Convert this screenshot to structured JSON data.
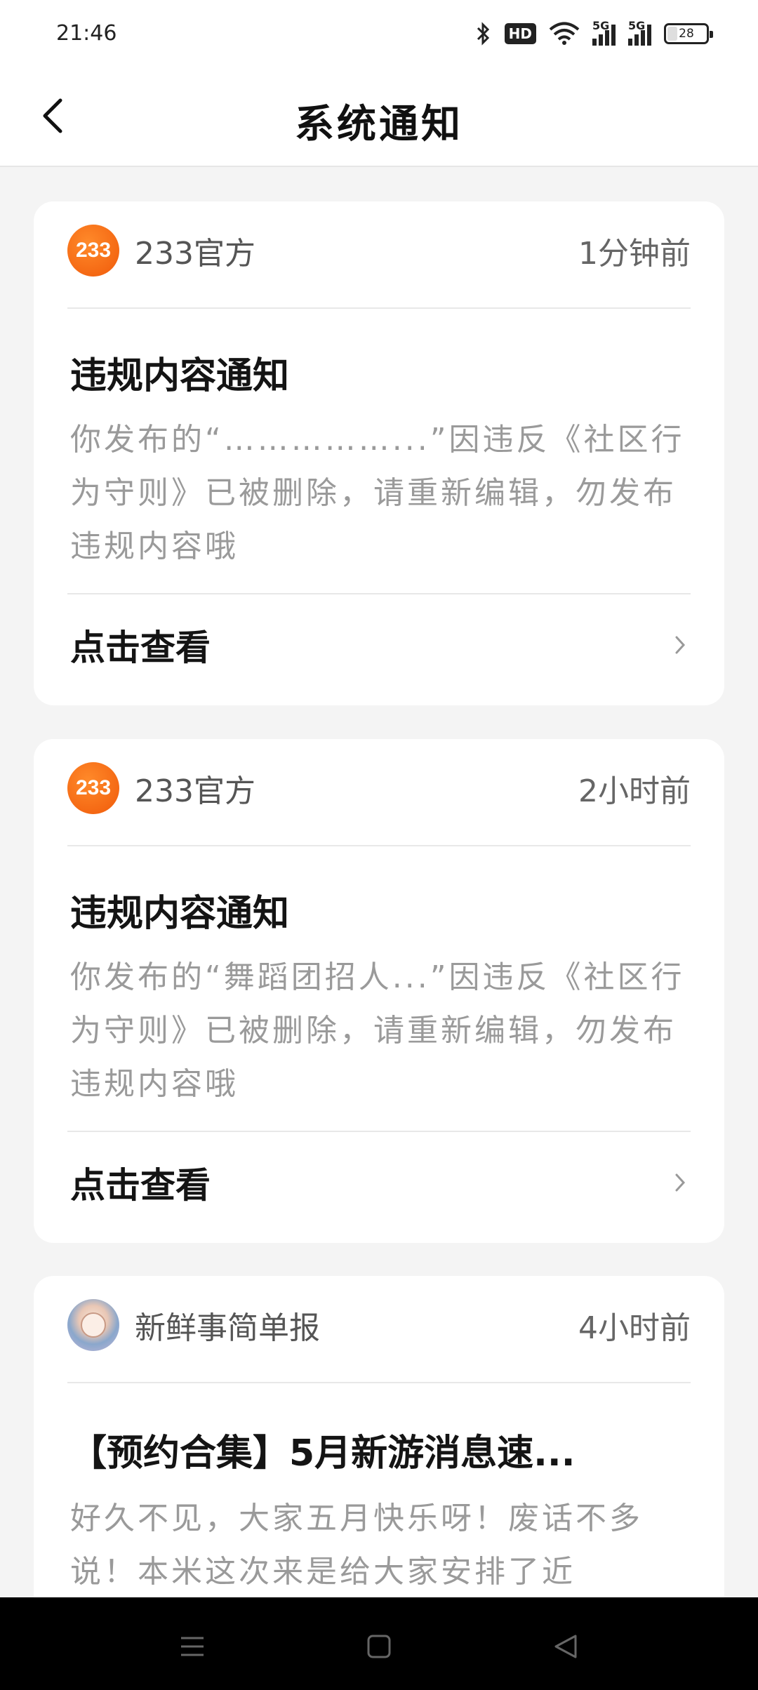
{
  "status_bar": {
    "time": "21:46",
    "hd_badge": "HD",
    "signal1_label": "5G",
    "signal2_label": "5G",
    "battery": "28",
    "icons": [
      "bluetooth-icon",
      "wifi-icon",
      "signal-icon",
      "battery-icon"
    ]
  },
  "header": {
    "title": "系统通知",
    "back_icon": "chevron-left-icon"
  },
  "notifications": [
    {
      "avatar_text": "233",
      "sender": "233官方",
      "time": "1分钟前",
      "title": "违规内容通知",
      "body": "你发布的“……………...”因违反《社区行为守则》已被删除，请重新编辑，勿发布违规内容哦",
      "link": "点击查看"
    },
    {
      "avatar_text": "233",
      "sender": "233官方",
      "time": "2小时前",
      "title": "违规内容通知",
      "body": "你发布的“舞蹈团招人...”因违反《社区行为守则》已被删除，请重新编辑，勿发布违规内容哦",
      "link": "点击查看"
    },
    {
      "sender": "新鲜事简单报",
      "time": "4小时前",
      "title": "【预约合集】5月新游消息速...",
      "body": "好久不见，大家五月快乐呀！废话不多说！本米这次来是给大家安排了近"
    }
  ],
  "accent_color": "#f26a15"
}
